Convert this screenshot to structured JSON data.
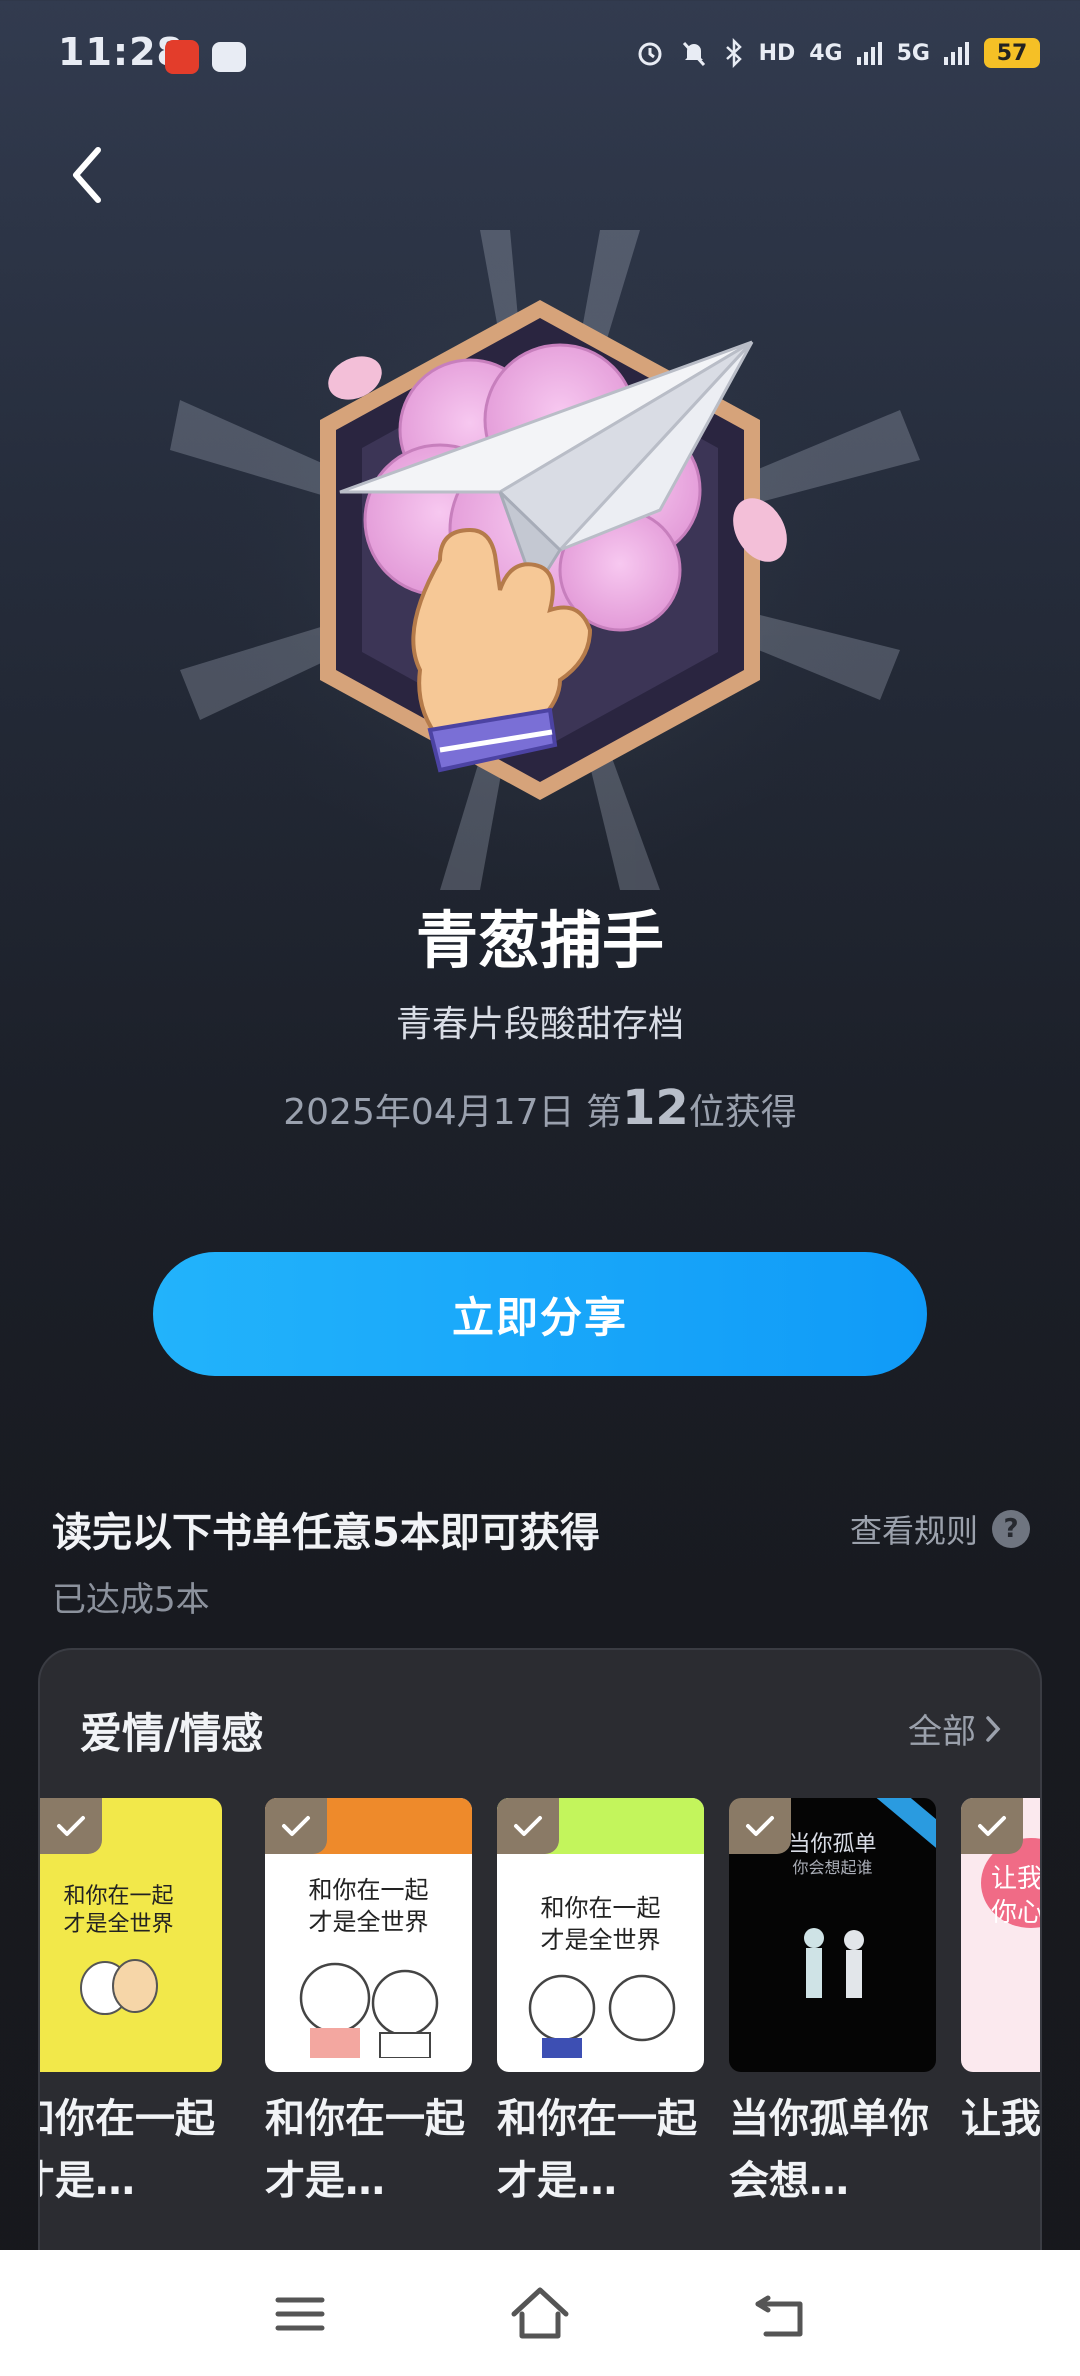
{
  "status_bar": {
    "time": "11:28",
    "battery": "57",
    "network_1": "4G",
    "network_2": "5G",
    "hd": "HD"
  },
  "badge": {
    "name": "青葱捕手",
    "description": "青春片段酸甜存档",
    "date": "2025年04月17日",
    "rank_prefix": "第",
    "rank": "12",
    "rank_suffix": "位获得"
  },
  "share_button": {
    "label": "立即分享"
  },
  "requirement": {
    "text": "读完以下书单任意5本即可获得",
    "progress": "已达成5本",
    "rules_label": "查看规则",
    "rules_icon": "?"
  },
  "book_list": {
    "category": "爱情/情感",
    "all_label": "全部",
    "books": [
      {
        "title": "和你在一起才是…",
        "cover_text_1": "和你在一起",
        "cover_text_2": "才是全世界",
        "completed": true
      },
      {
        "title": "和你在一起才是…",
        "cover_text_1": "和你在一起",
        "cover_text_2": "才是全世界",
        "completed": true
      },
      {
        "title": "和你在一起才是…",
        "cover_text_1": "和你在一起",
        "cover_text_2": "才是全世界",
        "completed": true
      },
      {
        "title": "当你孤单你会想…",
        "cover_text_1": "当你孤单",
        "cover_text_2": "你会想起谁",
        "completed": true
      },
      {
        "title": "让我你心",
        "cover_text_1": "让我",
        "cover_text_2": "你心",
        "completed": true
      }
    ]
  },
  "colors": {
    "accent": "#1ba6fa",
    "check_bg": "#8a7a66",
    "card_bg": "#2b2c31"
  },
  "icons": {
    "back": "chevron-left-icon",
    "menu": "menu-icon",
    "home": "home-icon",
    "return": "return-icon"
  }
}
